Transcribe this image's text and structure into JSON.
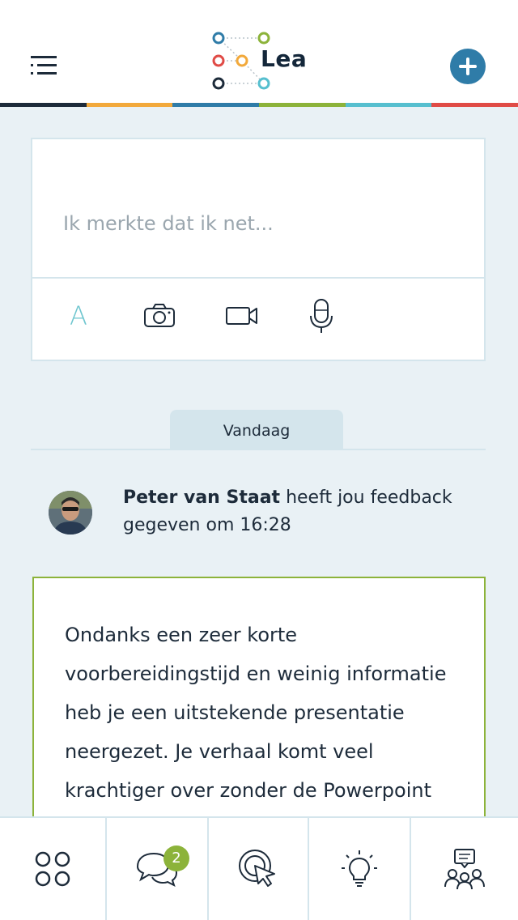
{
  "app": {
    "name": "Lea",
    "brand_colors": [
      "#1d2b3a",
      "#f2a93b",
      "#2f7ca8",
      "#8cb33a",
      "#56bfcf",
      "#e04b46"
    ]
  },
  "header": {
    "menu_icon": "menu-icon",
    "add_icon": "plus-circle-icon"
  },
  "composer": {
    "placeholder": "Ik merkte dat ik net...",
    "tools": [
      {
        "icon": "text-icon",
        "label": "A"
      },
      {
        "icon": "camera-icon"
      },
      {
        "icon": "video-icon"
      },
      {
        "icon": "microphone-icon"
      }
    ]
  },
  "timeline": {
    "day_label": "Vandaag",
    "event": {
      "author": "Peter van Staat",
      "text": " heeft jou feedback gegeven om 16:28"
    },
    "feedback": {
      "text": "Ondanks een zeer korte voorbereidingstijd en weinig informatie heb je een uitstekende presentatie neergezet. Je verhaal komt veel krachtiger over zonder de Powerpoint"
    }
  },
  "bottom_nav": {
    "items": [
      {
        "icon": "apps-grid-icon"
      },
      {
        "icon": "chat-bubbles-icon",
        "badge": "2"
      },
      {
        "icon": "target-cursor-icon"
      },
      {
        "icon": "lightbulb-icon"
      },
      {
        "icon": "group-chat-icon"
      }
    ]
  }
}
